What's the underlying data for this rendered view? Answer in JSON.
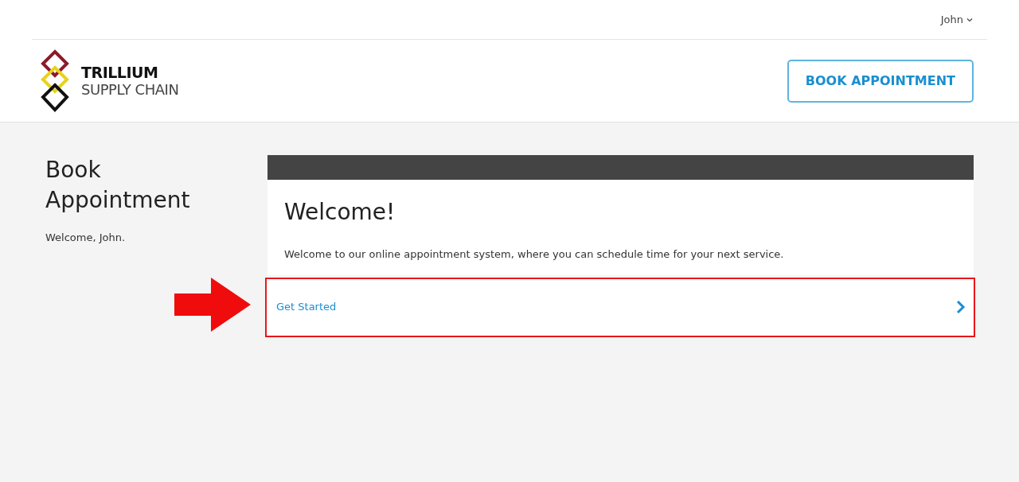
{
  "user_menu": {
    "label": "John"
  },
  "logo": {
    "line_1": "TRILLIUM",
    "line_2": "SUPPLY CHAIN"
  },
  "header_button": "BOOK APPOINTMENT",
  "sidebar": {
    "title": "Book Appointment",
    "greeting": "Welcome, John."
  },
  "card": {
    "heading": "Welcome!",
    "text": "Welcome to our online appointment system, where you can schedule time for your next service.",
    "action": {
      "label": "Get Started",
      "highlighted": true
    }
  }
}
